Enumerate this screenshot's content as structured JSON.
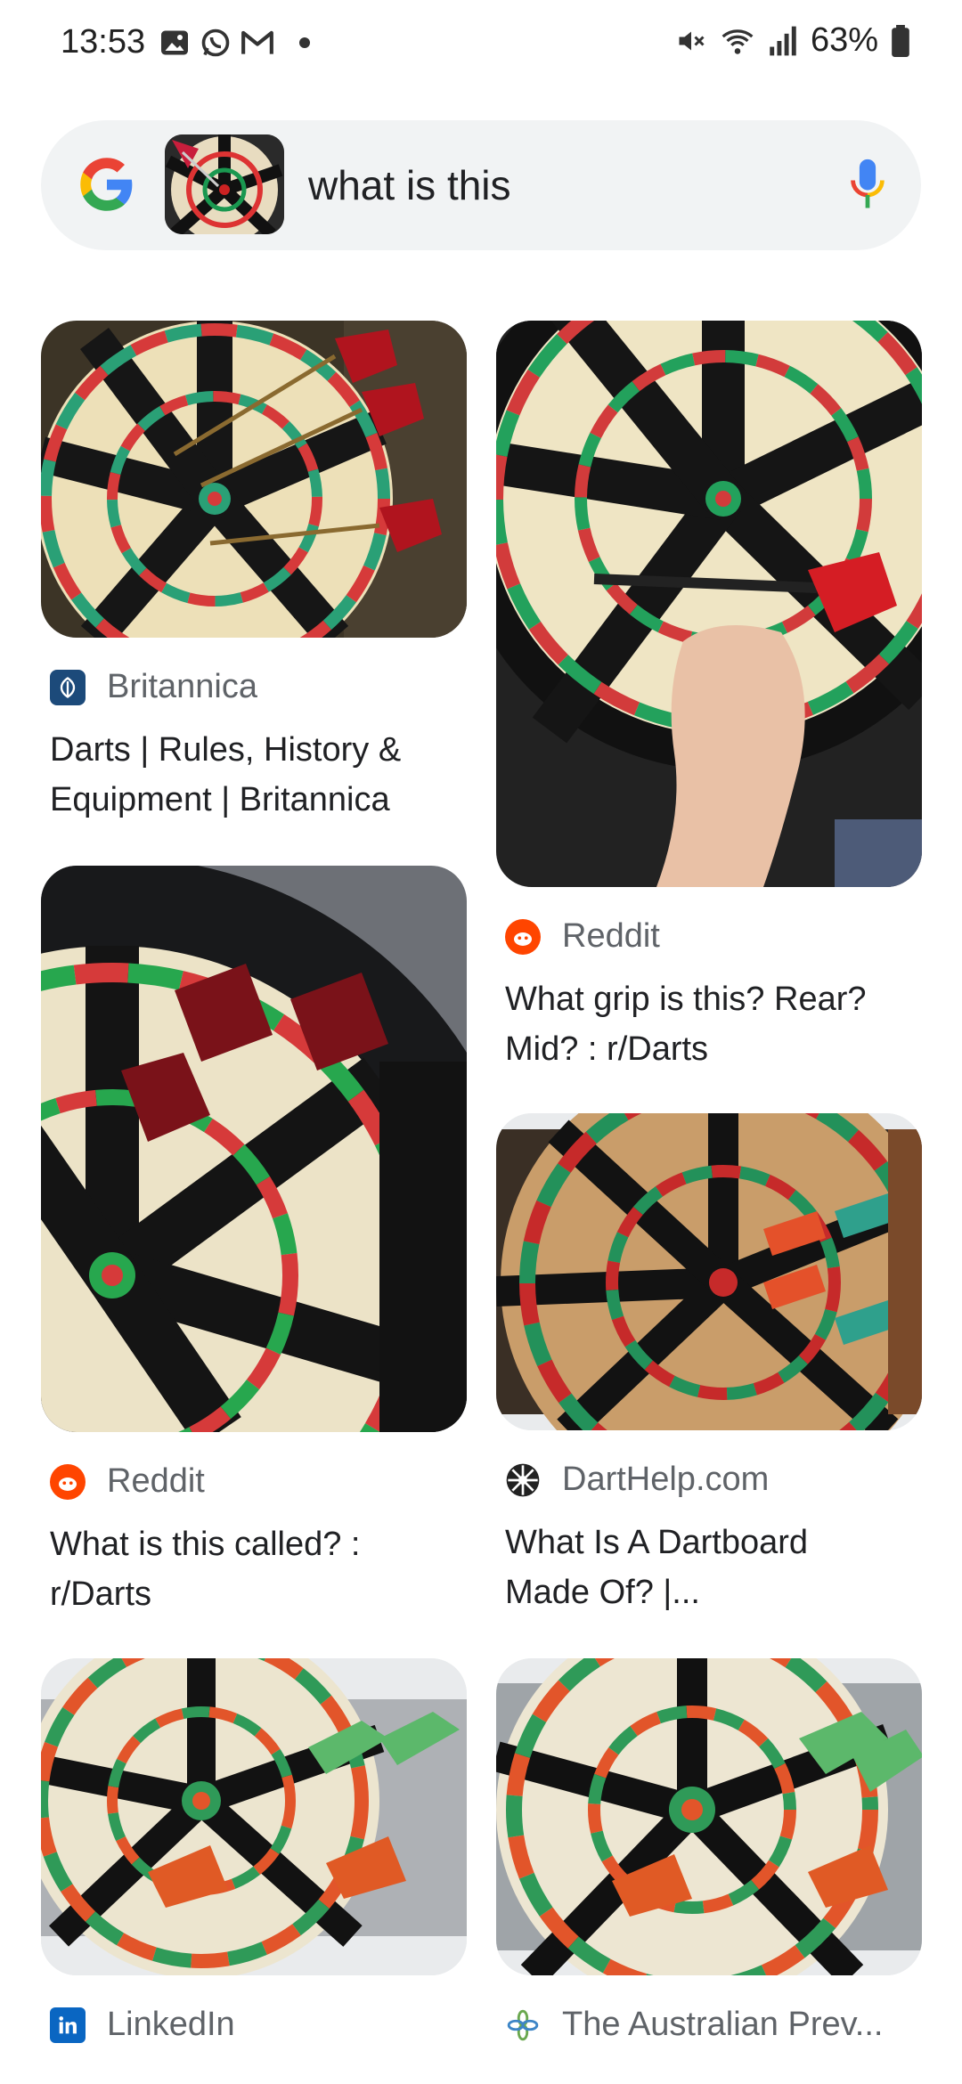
{
  "status": {
    "time": "13:53",
    "battery": "63%"
  },
  "search": {
    "query": "what is this"
  },
  "results": [
    {
      "source": "Britannica",
      "title_line1": "Darts | Rules, History &",
      "title_line2": "Equipment | Britannica"
    },
    {
      "source": "Reddit",
      "title_line1": "What grip is this? Rear?",
      "title_line2": "Mid? : r/Darts"
    },
    {
      "source": "Reddit",
      "title_line1": "What is this called? :",
      "title_line2": "r/Darts"
    },
    {
      "source": "DartHelp.com",
      "title_line1": "What Is A Dartboard",
      "title_line2": "Made Of? |..."
    },
    {
      "source": "LinkedIn"
    },
    {
      "source": "The Australian Prev..."
    }
  ],
  "colors": {
    "google_blue": "#4285F4",
    "google_red": "#EA4335",
    "google_yellow": "#FBBC05",
    "google_green": "#34A853",
    "reddit": "#FF4500",
    "linkedin": "#0A66C2",
    "britannica": "#1c4a7a"
  },
  "icons": [
    "gallery-icon",
    "whatsapp-icon",
    "gmail-icon",
    "mute-icon",
    "wifi-icon",
    "signal-icon",
    "battery-icon",
    "google-logo-icon",
    "mic-icon"
  ]
}
